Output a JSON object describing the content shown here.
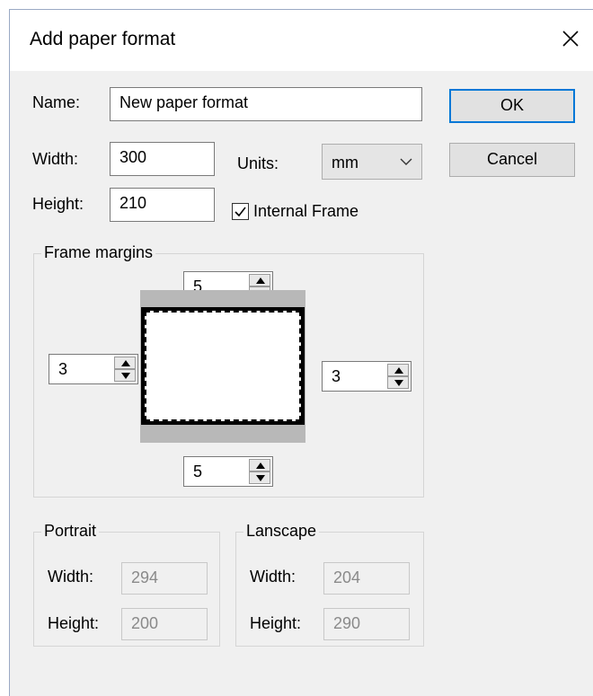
{
  "window": {
    "title": "Add paper format"
  },
  "buttons": {
    "ok": "OK",
    "cancel": "Cancel"
  },
  "name": {
    "label": "Name:",
    "value": "New paper format"
  },
  "width": {
    "label": "Width:",
    "value": "300"
  },
  "height": {
    "label": "Height:",
    "value": "210"
  },
  "units": {
    "label": "Units:",
    "value": "mm"
  },
  "internal_frame": {
    "label": "Internal Frame",
    "checked": true
  },
  "frame_margins": {
    "title": "Frame margins",
    "top": "5",
    "bottom": "5",
    "left": "3",
    "right": "3"
  },
  "portrait": {
    "title": "Portrait",
    "width_label": "Width:",
    "width": "294",
    "height_label": "Height:",
    "height": "200"
  },
  "landscape": {
    "title": "Lanscape",
    "width_label": "Width:",
    "width": "204",
    "height_label": "Height:",
    "height": "290"
  },
  "icons": {
    "close": "close-icon",
    "chevron": "chevron-down-icon",
    "check": "checkmark-icon",
    "spin_up": "spin-up-icon",
    "spin_down": "spin-down-icon"
  }
}
